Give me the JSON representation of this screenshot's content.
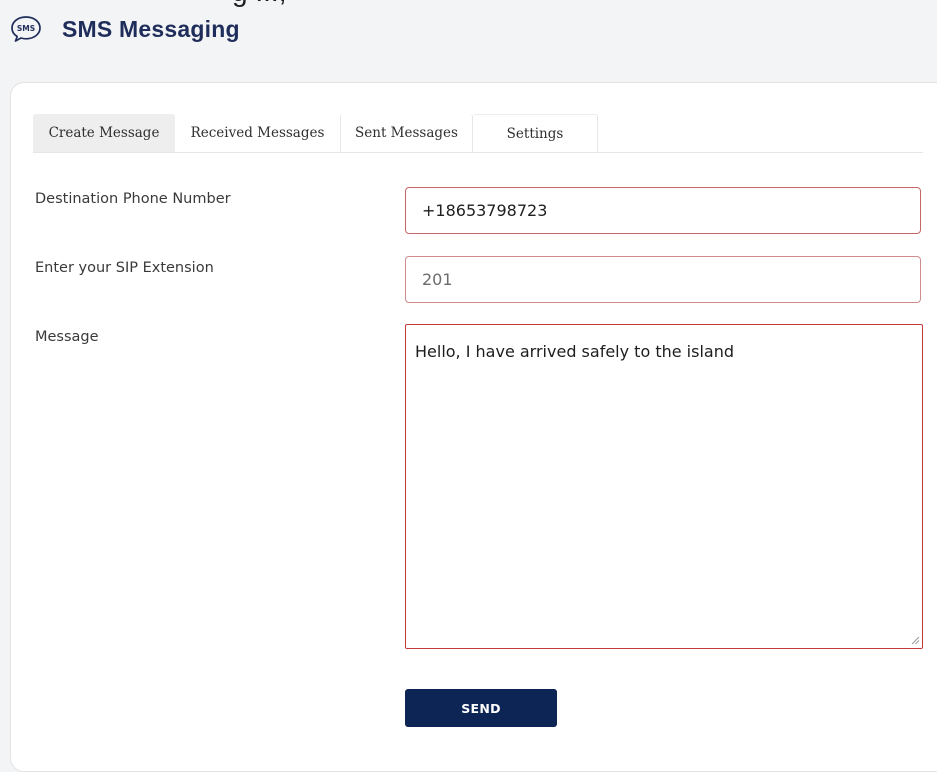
{
  "top_cutoff_text": "g ..., ",
  "app": {
    "icon": "sms-bubble-icon",
    "icon_text": "SMS",
    "title": "SMS Messaging",
    "title_color": "#1f2d5a"
  },
  "tabs": [
    {
      "label": "Create Message",
      "active": true
    },
    {
      "label": "Received Messages",
      "active": false
    },
    {
      "label": "Sent Messages",
      "active": false
    },
    {
      "label": "Settings",
      "active": false
    }
  ],
  "form": {
    "destination": {
      "label": "Destination Phone Number",
      "value": "+18653798723"
    },
    "sip_extension": {
      "label": "Enter your SIP Extension",
      "value": "201"
    },
    "message": {
      "label": "Message",
      "value": "Hello, I have arrived safely to the island"
    },
    "send_label": "SEND"
  },
  "colors": {
    "primary": "#0d2554",
    "input_border": "#c56767",
    "page_bg": "#f3f4f6"
  }
}
